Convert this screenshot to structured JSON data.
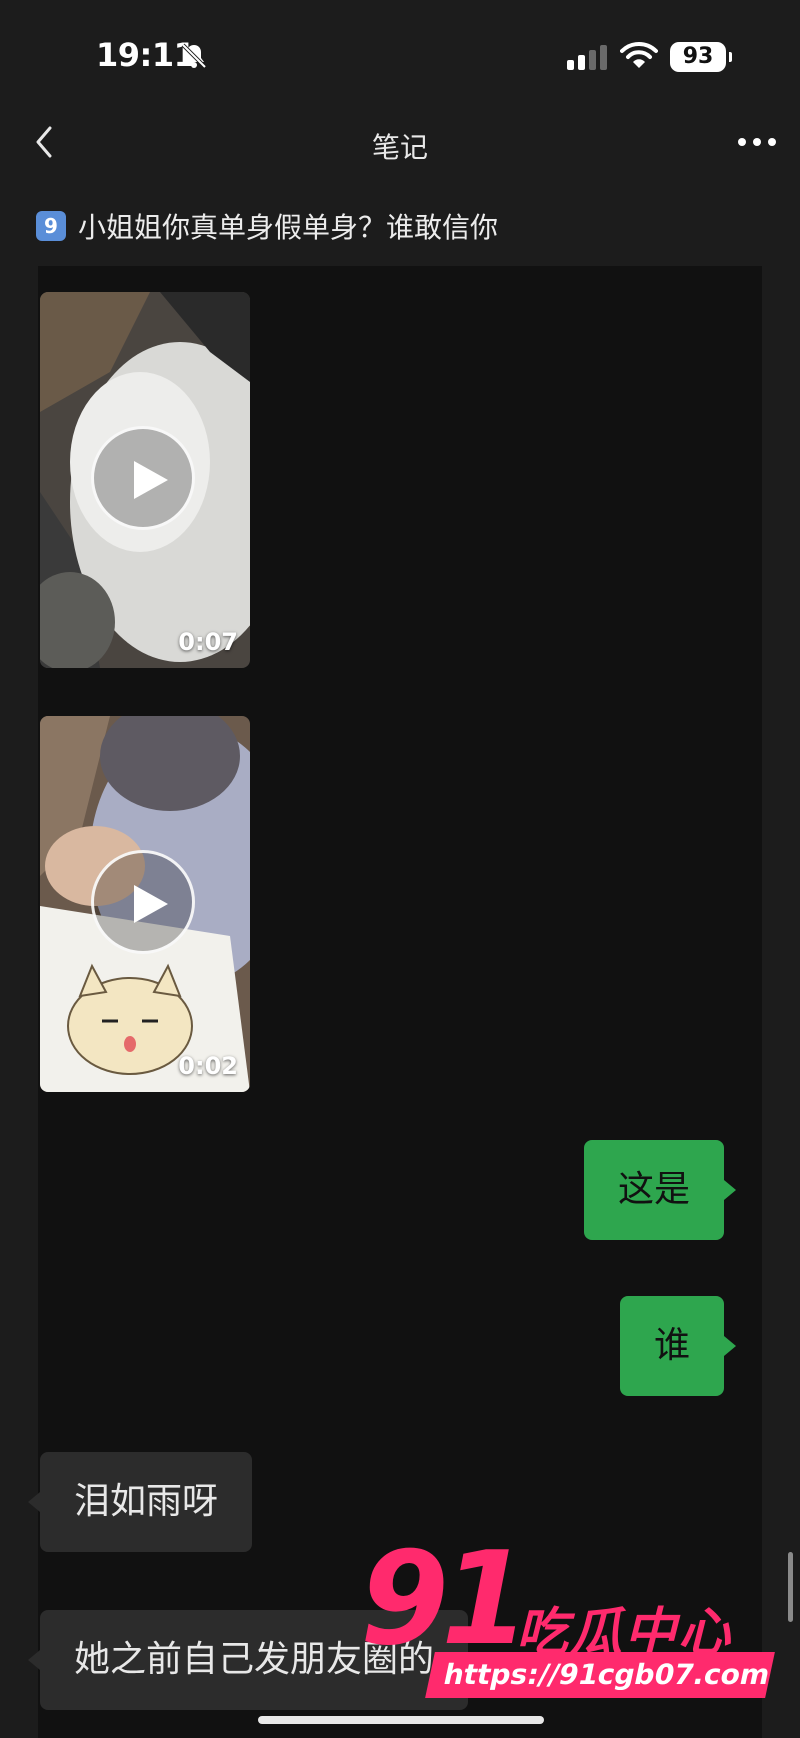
{
  "status_bar": {
    "time": "19:11",
    "battery": "93"
  },
  "nav": {
    "title": "笔记"
  },
  "note": {
    "index": "9",
    "title": "小姐姐你真单身假单身？谁敢信你"
  },
  "messages": {
    "video1_duration": "0:07",
    "video2_duration": "0:02",
    "out1": "这是",
    "out2": "谁",
    "in1": "泪如雨呀",
    "in2": "她之前自己发朋友圈的"
  },
  "watermark": {
    "number": "91",
    "brand": "吃瓜中心",
    "url": "https://91cgb07.com"
  },
  "colors": {
    "background": "#1c1c1c",
    "chat_background": "#111111",
    "outgoing_bubble": "#2ea64e",
    "incoming_bubble": "#2c2c2c",
    "watermark": "#ff2a6d"
  }
}
